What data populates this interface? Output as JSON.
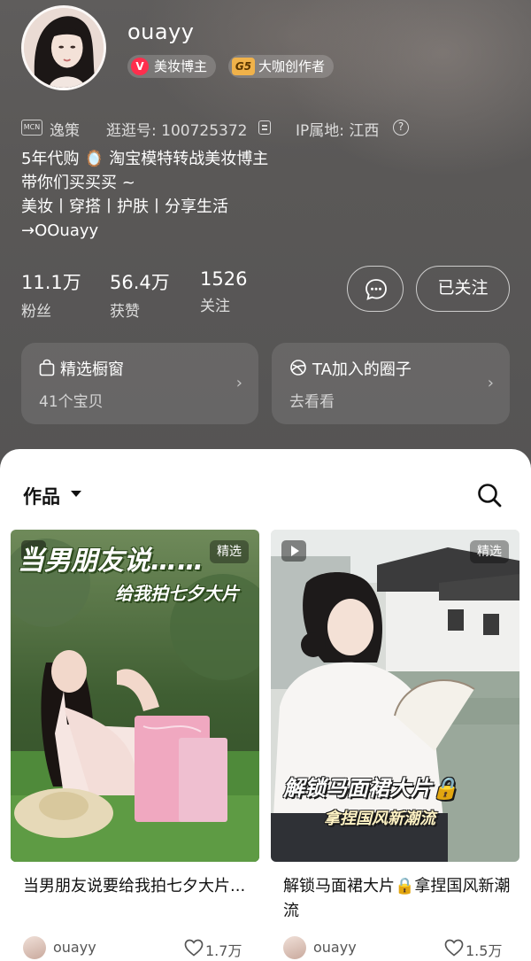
{
  "profile": {
    "username": "ouayy",
    "badges": [
      {
        "icon": "v-badge-icon",
        "label": "美妆博主"
      },
      {
        "icon": "g5-badge-icon",
        "label": "大咖创作者"
      }
    ],
    "mcn_tag": "MCN",
    "mcn_name": "逸策",
    "id_text": "逛逛号: 100725372",
    "ip_text": "IP属地: 江西",
    "bio": [
      "5年代购 🪞 淘宝模特转战美妆博主",
      "带你们买买买 ~",
      "美妆丨穿搭丨护肤丨分享生活",
      "→OOuayy"
    ]
  },
  "stats": [
    {
      "value": "11.1万",
      "label": "粉丝"
    },
    {
      "value": "56.4万",
      "label": "获赞"
    },
    {
      "value": "1526",
      "label": "关注"
    }
  ],
  "actions": {
    "follow_label": "已关注"
  },
  "cards": {
    "shop": {
      "title": "精选橱窗",
      "subtitle": "41个宝贝"
    },
    "circle": {
      "title": "TA加入的圈子",
      "subtitle": "去看看"
    }
  },
  "content": {
    "tab_label": "作品",
    "notes": [
      {
        "badge": "精选",
        "cover_text_line1": "当男朋友说……",
        "cover_text_line2": "给我拍七夕大片",
        "title": "当男朋友说要给我拍七夕大片...",
        "author": "ouayy",
        "likes": "1.7万"
      },
      {
        "badge": "精选",
        "cover_text_line1": "解锁马面裙大片🔒",
        "cover_text_line2": "拿捏国风新潮流",
        "title": "解锁马面裙大片🔒拿捏国风新潮流",
        "author": "ouayy",
        "likes": "1.5万"
      }
    ]
  },
  "colors": {
    "header_bg": "#575656",
    "badge_red": "#ff2e4d",
    "badge_gold": "#f0b24a"
  }
}
